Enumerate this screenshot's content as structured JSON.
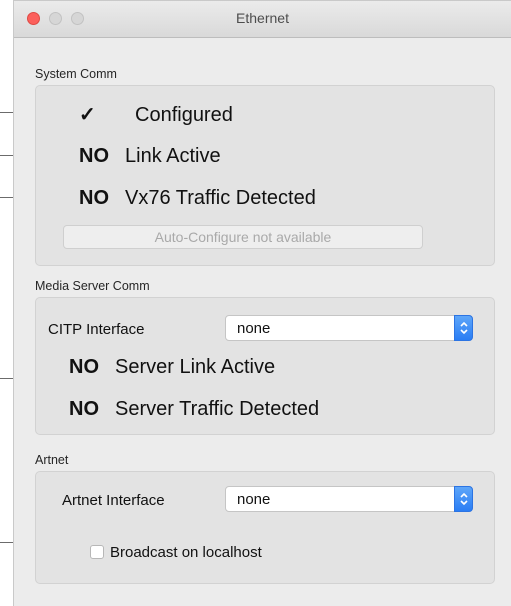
{
  "window": {
    "title": "Ethernet"
  },
  "system_comm": {
    "label": "System Comm",
    "rows": [
      {
        "mark": "✓",
        "text": "Configured"
      },
      {
        "mark": "NO",
        "text": "Link Active"
      },
      {
        "mark": "NO",
        "text": "Vx76 Traffic Detected"
      }
    ],
    "auto_configure_button": "Auto-Configure not available"
  },
  "media_server_comm": {
    "label": "Media Server Comm",
    "citp_label": "CITP Interface",
    "citp_value": "none",
    "rows": [
      {
        "mark": "NO",
        "text": "Server Link Active"
      },
      {
        "mark": "NO",
        "text": "Server Traffic Detected"
      }
    ]
  },
  "artnet": {
    "label": "Artnet",
    "interface_label": "Artnet Interface",
    "interface_value": "none",
    "broadcast_label": "Broadcast on localhost",
    "broadcast_checked": false
  },
  "icons": {
    "titlebar_buttons": [
      "close-button-icon",
      "minimize-button-icon",
      "zoom-button-icon"
    ],
    "select_arrow": "updown-chevron-icon"
  },
  "colors": {
    "close": "#fc605c",
    "select_accent": "#2a7df4",
    "panel_bg": "#ececec"
  }
}
